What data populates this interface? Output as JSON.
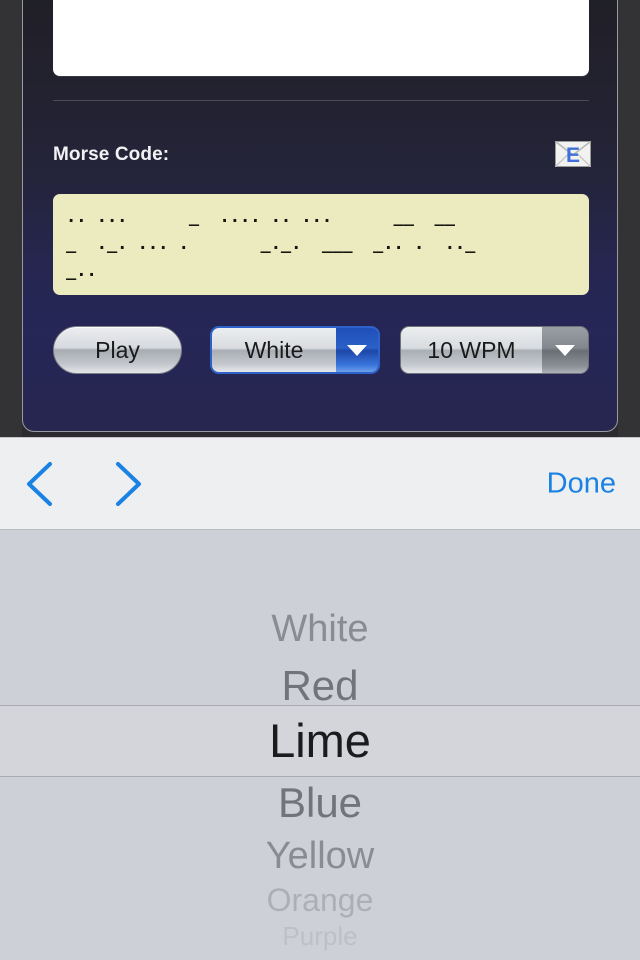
{
  "app": {
    "morse_label": "Morse Code:",
    "mail_icon_letter": "E",
    "text_field_value": "",
    "morse_lines": [
      ".. ...      _  .... .. ...      __  __",
      "_  ._. ... .       _._.  ___  _.. .  .._",
      "_.."
    ],
    "morse_line_1": ".. ...      _  .... .. ...      __  __",
    "morse_line_2": "_  ._. ... .       _._.  ___  _.. .  .._",
    "morse_line_3": "_.."
  },
  "controls": {
    "play_label": "Play",
    "color_value": "White",
    "color_arrow_icon": "chevron-down-icon",
    "speed_value": "10 WPM",
    "speed_arrow_icon": "chevron-down-icon"
  },
  "toolbar": {
    "prev_icon": "chevron-left-icon",
    "next_icon": "chevron-right-icon",
    "done_label": "Done"
  },
  "picker": {
    "selected_index": 2,
    "options": [
      {
        "label": "White"
      },
      {
        "label": "Red"
      },
      {
        "label": "Lime"
      },
      {
        "label": "Blue"
      },
      {
        "label": "Yellow"
      },
      {
        "label": "Orange"
      },
      {
        "label": "Purple"
      }
    ]
  },
  "colors": {
    "accent_blue": "#1a82e2",
    "focus_blue": "#2d63c8",
    "morse_box_bg": "#ecebbf",
    "panel_top": "#201f26",
    "panel_bottom": "#262657",
    "picker_bg": "#cdd0d6"
  }
}
